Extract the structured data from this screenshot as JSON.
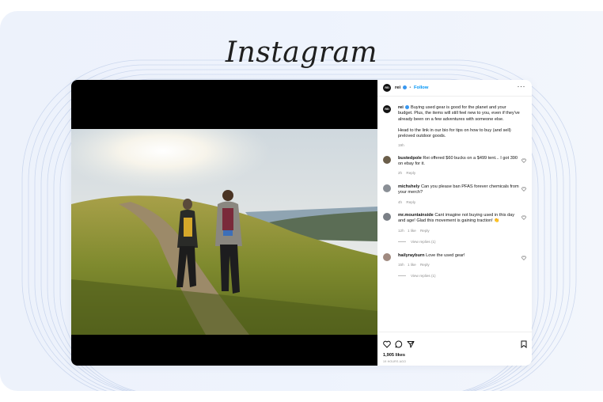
{
  "brand": {
    "logo_text": "Instagram"
  },
  "post": {
    "username": "rei",
    "avatar_text": "REI",
    "follow_label": "Follow",
    "separator": "•",
    "more_label": "···",
    "caption_user": "rei",
    "caption_text": "Buying used gear is good for the planet and your budget. Plus, the items will still feel new to you, even if they've already been on a few adventures with someone else.",
    "caption_text_2": "Head to the link in our bio for tips on how to buy (and sell) preloved outdoor goods.",
    "caption_time": "19h",
    "comments": [
      {
        "user": "bustedpole",
        "text": "Rei offered $60 bucks on a $499 tent... I got 390 on ebay for it.",
        "time": "2h",
        "likes": "",
        "reply_label": "Reply",
        "replies": "",
        "avatar_color": "#6b5e4a"
      },
      {
        "user": "michshely",
        "text": "Can you please ban PFAS forever chemicals from your merch?",
        "time": "4h",
        "likes": "",
        "reply_label": "Reply",
        "replies": "",
        "avatar_color": "#8a8f96"
      },
      {
        "user": "mr.mountainside",
        "text": "Cant imagine not buying used in this day and age! Glad this movement is gaining traction! 👏",
        "time": "12h",
        "likes": "1 like",
        "reply_label": "Reply",
        "replies": "View replies (1)",
        "avatar_color": "#7a7f86"
      },
      {
        "user": "hailyrayburn",
        "text": "Love the used gear!",
        "time": "15h",
        "likes": "1 like",
        "reply_label": "Reply",
        "replies": "View replies (1)",
        "avatar_color": "#a08a80"
      }
    ],
    "likes_count": "1,905 likes",
    "posted_ago": "19 HOURS AGO"
  },
  "colors": {
    "follow": "#0095f6",
    "verified": "#3897f0",
    "muted": "#8e8e8e"
  },
  "icons": [
    "heart-icon",
    "comment-icon",
    "share-icon",
    "bookmark-icon",
    "more-icon",
    "verified-icon"
  ]
}
